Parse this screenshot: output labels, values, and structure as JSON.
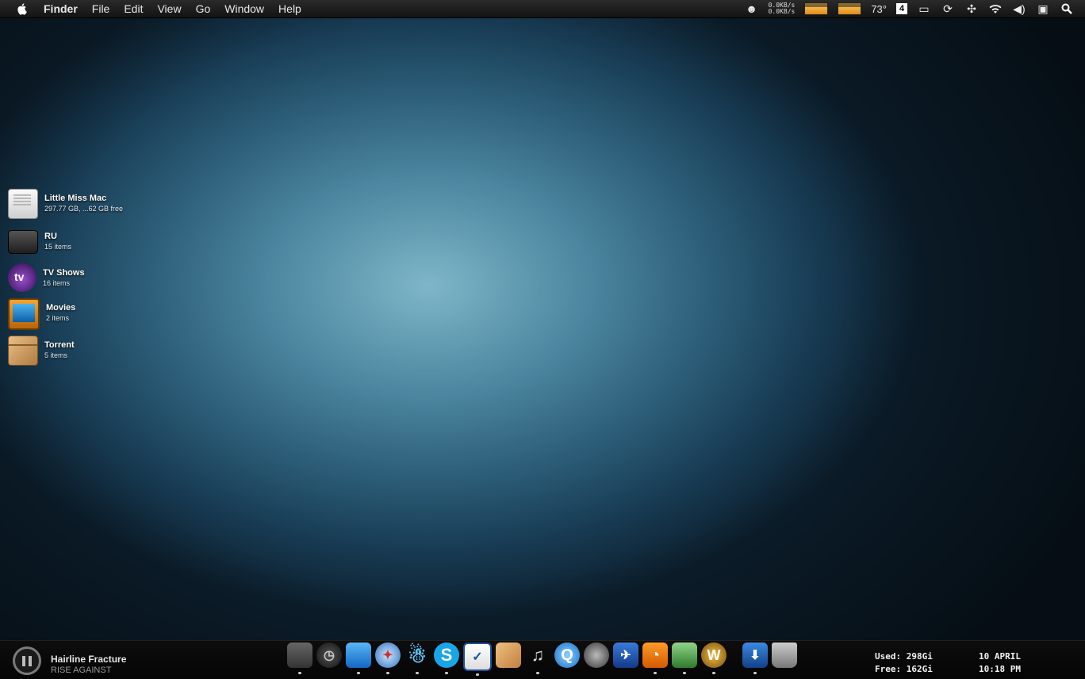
{
  "menubar": {
    "app": "Finder",
    "menus": [
      "File",
      "Edit",
      "View",
      "Go",
      "Window",
      "Help"
    ],
    "net_up": "0.0KB/s",
    "net_down": "0.0KB/s",
    "temperature": "73°",
    "spaces_number": "4",
    "icons": [
      "apple-icon",
      "activity-monitor-icon",
      "display-icon",
      "time-machine-icon",
      "bluetooth-icon",
      "wifi-icon",
      "volume-icon",
      "battery-icon",
      "spotlight-icon"
    ]
  },
  "desktop": {
    "items": [
      {
        "name": "Little Miss Mac",
        "sub": "297.77 GB, ...62 GB free",
        "icon": "hard-drive-icon"
      },
      {
        "name": "RU",
        "sub": "15 items",
        "icon": "external-drive-icon"
      },
      {
        "name": "TV Shows",
        "sub": "16 items",
        "icon": "apple-tv-icon"
      },
      {
        "name": "Movies",
        "sub": "2 items",
        "icon": "movies-tv-icon"
      },
      {
        "name": "Torrent",
        "sub": "5 items",
        "icon": "box-icon"
      }
    ]
  },
  "now_playing": {
    "title": "Hairline Fracture",
    "artist": "RISE AGAINST"
  },
  "dock": {
    "apps": [
      {
        "icon": "finder-icon",
        "running": true
      },
      {
        "icon": "dashboard-icon",
        "running": false
      },
      {
        "icon": "mail-icon",
        "running": true
      },
      {
        "icon": "safari-icon",
        "running": true
      },
      {
        "icon": "adium-icon",
        "running": true
      },
      {
        "icon": "skype-icon",
        "running": true
      },
      {
        "icon": "things-icon",
        "running": true
      },
      {
        "icon": "package-icon",
        "running": false
      },
      {
        "icon": "headphones-icon",
        "running": true
      },
      {
        "icon": "quicktime-icon",
        "running": false
      },
      {
        "icon": "dvd-player-icon",
        "running": false
      },
      {
        "icon": "transmit-icon",
        "running": false
      },
      {
        "icon": "rss-icon",
        "running": true
      },
      {
        "icon": "preview-icon",
        "running": true
      },
      {
        "icon": "world-of-warcraft-icon",
        "running": true
      },
      {
        "icon": "downloads-stack-icon",
        "running": true
      },
      {
        "icon": "trash-icon",
        "running": false
      }
    ]
  },
  "disk": {
    "used": "Used: 298Gi",
    "free": "Free: 162Gi"
  },
  "clock": {
    "date": "10 APRIL",
    "time": "10:18 PM"
  }
}
